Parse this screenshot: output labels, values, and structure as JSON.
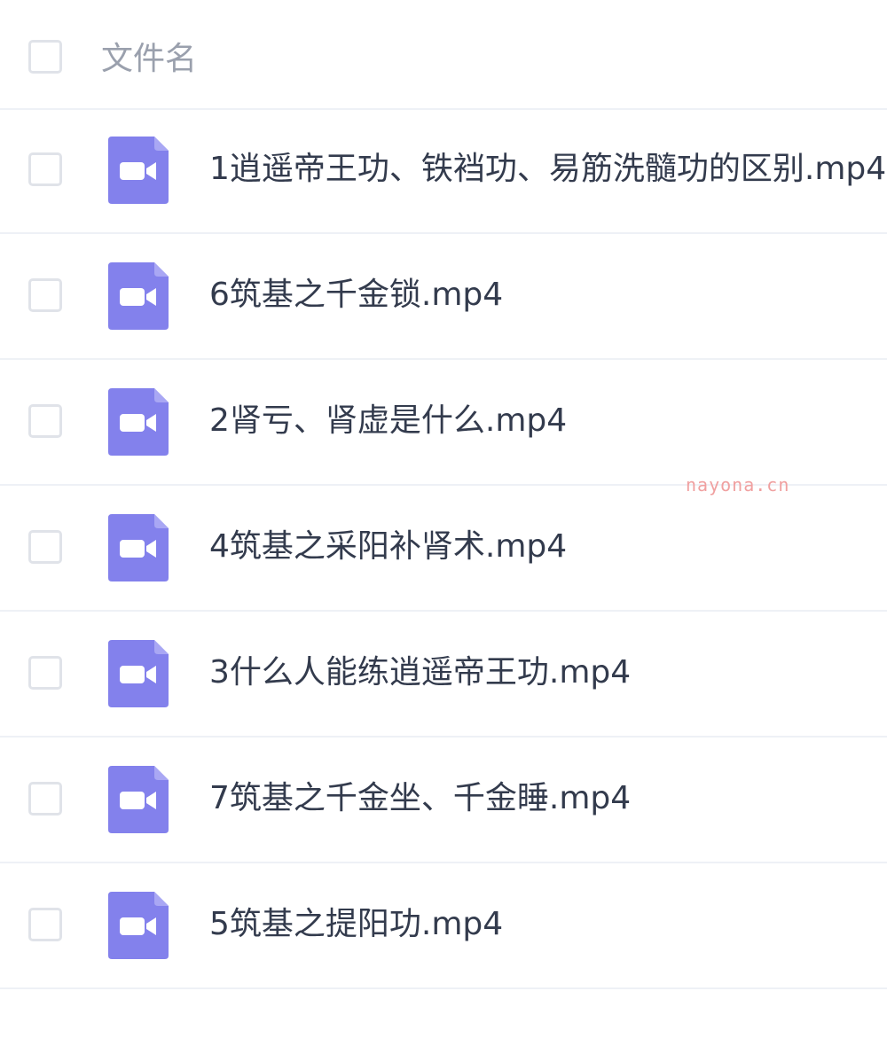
{
  "header": {
    "column_label": "文件名"
  },
  "files": [
    {
      "name": "1逍遥帝王功、铁裆功、易筋洗髓功的区别.mp4",
      "icon": "video-file-icon"
    },
    {
      "name": "6筑基之千金锁.mp4",
      "icon": "video-file-icon"
    },
    {
      "name": "2肾亏、肾虚是什么.mp4",
      "icon": "video-file-icon"
    },
    {
      "name": "4筑基之采阳补肾术.mp4",
      "icon": "video-file-icon"
    },
    {
      "name": "3什么人能练逍遥帝王功.mp4",
      "icon": "video-file-icon"
    },
    {
      "name": "7筑基之千金坐、千金睡.mp4",
      "icon": "video-file-icon"
    },
    {
      "name": "5筑基之提阳功.mp4",
      "icon": "video-file-icon"
    }
  ],
  "watermark": "nayona.cn",
  "colors": {
    "icon_fill": "#8381ec",
    "icon_fold": "#a9a7f4",
    "text": "#333b4d",
    "header_text": "#9aa0ad",
    "divider": "#eef1f6",
    "checkbox_border": "#e0e3e9",
    "watermark": "#f0a0a0"
  }
}
